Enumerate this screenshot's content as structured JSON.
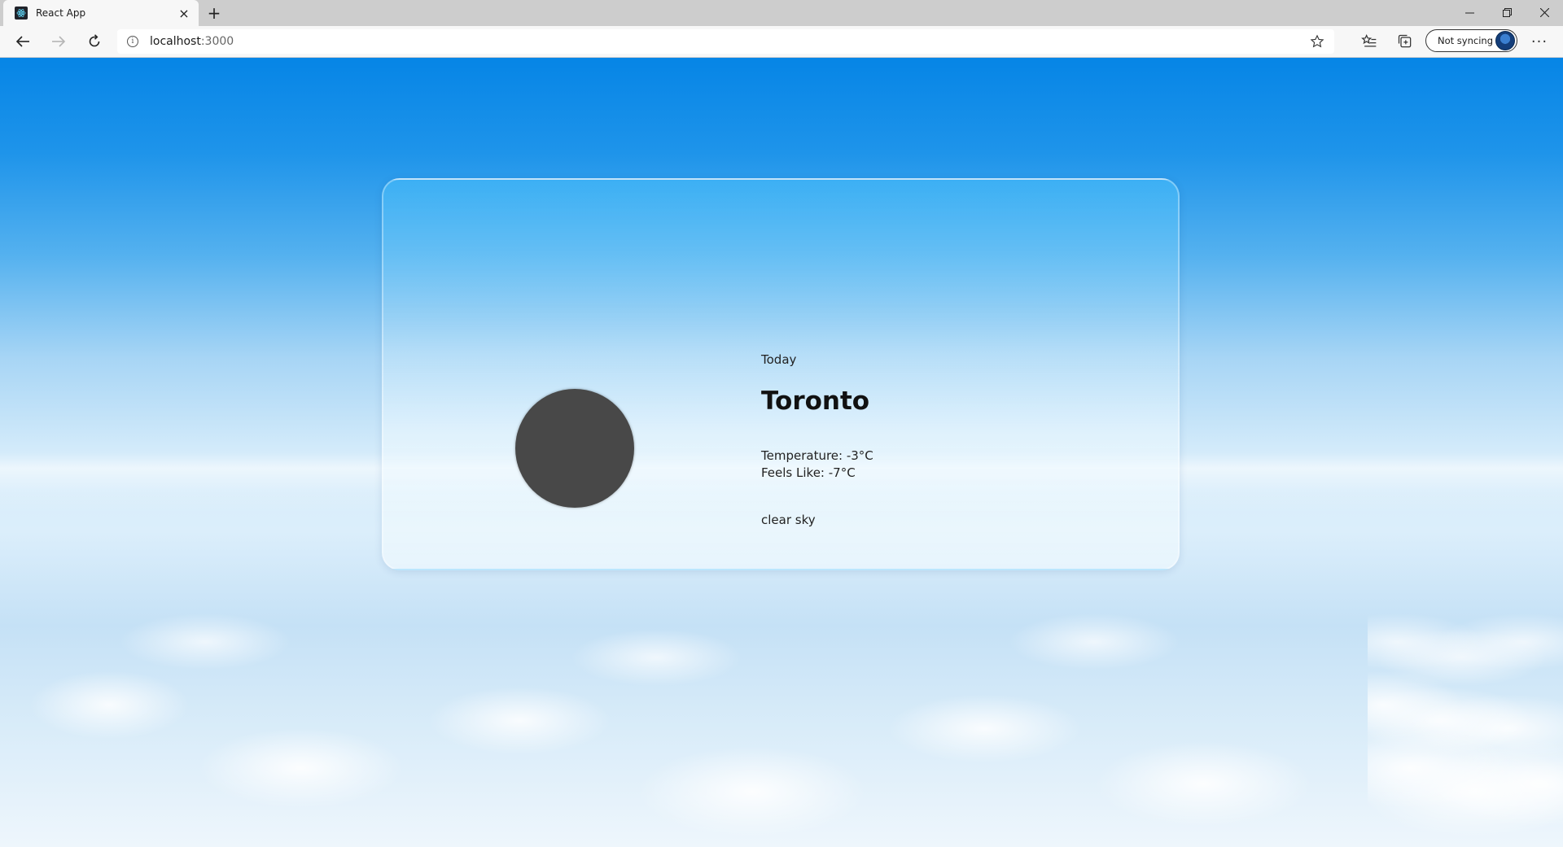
{
  "browser": {
    "tab_title": "React App",
    "tab_close": "×",
    "new_tab": "+",
    "url_host": "localhost",
    "url_port": ":3000",
    "sync_label": "Not syncing",
    "more": "···"
  },
  "weather": {
    "day": "Today",
    "city": "Toronto",
    "temperature": "Temperature: -3°C",
    "feels_like": "Feels Like: -7°C",
    "description": "clear sky"
  },
  "colors": {
    "sky_top": "#0685e6",
    "icon_circle": "#484848"
  }
}
